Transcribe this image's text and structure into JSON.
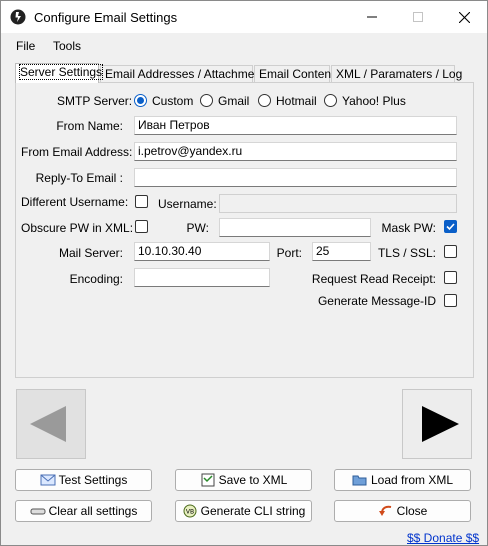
{
  "window": {
    "title": "Configure Email Settings"
  },
  "menu": {
    "file": "File",
    "tools": "Tools"
  },
  "tabs": [
    {
      "label": "Server Settings"
    },
    {
      "label": "Email Addresses / Attachment"
    },
    {
      "label": "Email Content"
    },
    {
      "label": "XML / Paramaters / Log"
    }
  ],
  "smtp": {
    "label": "SMTP Server:",
    "options": [
      "Custom",
      "Gmail",
      "Hotmail",
      "Yahoo! Plus"
    ],
    "selected": "Custom"
  },
  "fields": {
    "from_name_label": "From Name:",
    "from_name_value": "Иван Петров",
    "from_email_label": "From Email Address:",
    "from_email_value": "i.petrov@yandex.ru",
    "reply_to_label": "Reply-To Email :",
    "reply_to_value": "",
    "diff_user_label": "Different Username:",
    "username_label": "Username:",
    "username_value": "",
    "obscure_label": "Obscure PW in XML:",
    "pw_label": "PW:",
    "pw_value": "",
    "mask_pw_label": "Mask PW:",
    "mail_server_label": "Mail Server:",
    "mail_server_value": "10.10.30.40",
    "port_label": "Port:",
    "port_value": "25",
    "tls_label": "TLS / SSL:",
    "encoding_label": "Encoding:",
    "encoding_value": "",
    "read_receipt_label": "Request Read Receipt:",
    "message_id_label": "Generate Message-ID"
  },
  "checks": {
    "different_username": false,
    "obscure_pw": false,
    "mask_pw": true,
    "tls_ssl": false,
    "read_receipt": false,
    "message_id": false
  },
  "buttons": {
    "test": "Test Settings",
    "save": "Save to XML",
    "load": "Load from XML",
    "clear": "Clear all settings",
    "cli": "Generate CLI string",
    "close": "Close"
  },
  "donate": "$$ Donate $$",
  "colors": {
    "accent": "#0a5fc8",
    "link": "#0033cc"
  }
}
